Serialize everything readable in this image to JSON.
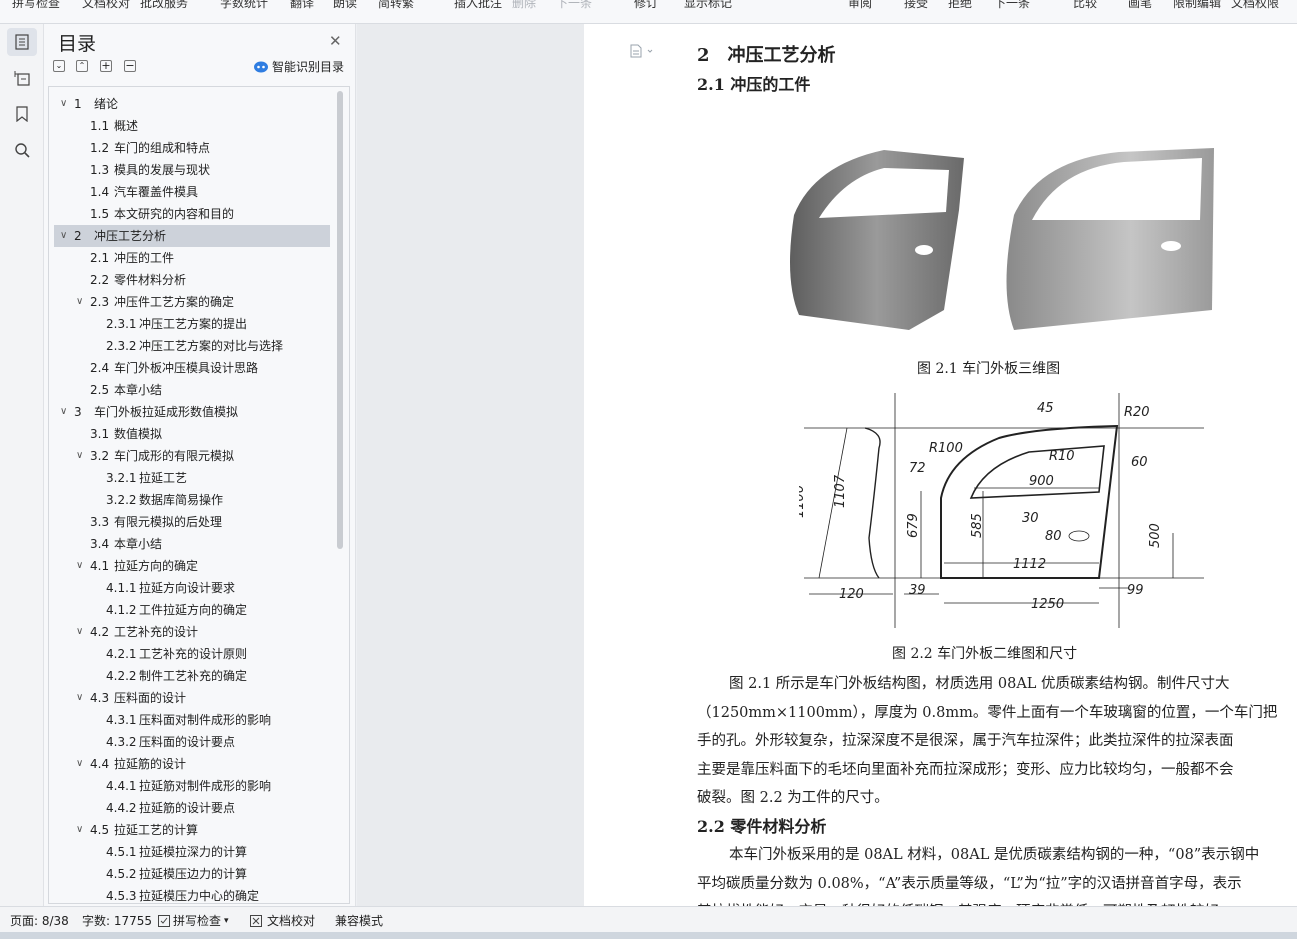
{
  "toolbar": {
    "items": [
      {
        "label": "拼写检查",
        "dim": false
      },
      {
        "label": "文档校对",
        "dim": false
      },
      {
        "label": "批改服务",
        "dim": false
      },
      {
        "label": "字数统计",
        "dim": false
      },
      {
        "label": "翻译",
        "dim": false
      },
      {
        "label": "朗读",
        "dim": false
      },
      {
        "label": "简转繁",
        "dim": false
      },
      {
        "label": "插入批注",
        "dim": false
      },
      {
        "label": "删除",
        "dim": true
      },
      {
        "label": "下一条",
        "dim": true
      },
      {
        "label": "修订",
        "dim": false
      },
      {
        "label": "显示标记",
        "dim": false
      },
      {
        "label": "审阅",
        "dim": false
      },
      {
        "label": "接受",
        "dim": false
      },
      {
        "label": "拒绝",
        "dim": false
      },
      {
        "label": "下一条",
        "dim": false
      },
      {
        "label": "比较",
        "dim": false
      },
      {
        "label": "画笔",
        "dim": false
      },
      {
        "label": "限制编辑",
        "dim": false
      },
      {
        "label": "文档权限",
        "dim": false
      }
    ]
  },
  "toc": {
    "title": "目录",
    "smart_label": "智能识别目录",
    "items": [
      {
        "num": "1",
        "label": "绪论",
        "level": 1,
        "expandable": true
      },
      {
        "num": "1.1",
        "label": "概述",
        "level": 2,
        "expandable": false
      },
      {
        "num": "1.2",
        "label": "车门的组成和特点",
        "level": 2,
        "expandable": false
      },
      {
        "num": "1.3",
        "label": "模具的发展与现状",
        "level": 2,
        "expandable": false
      },
      {
        "num": "1.4",
        "label": "汽车覆盖件模具",
        "level": 2,
        "expandable": false
      },
      {
        "num": "1.5",
        "label": "本文研究的内容和目的",
        "level": 2,
        "expandable": false
      },
      {
        "num": "2",
        "label": "冲压工艺分析",
        "level": 1,
        "expandable": true,
        "selected": true
      },
      {
        "num": "2.1",
        "label": "冲压的工件",
        "level": 2,
        "expandable": false
      },
      {
        "num": "2.2",
        "label": "零件材料分析",
        "level": 2,
        "expandable": false
      },
      {
        "num": "2.3",
        "label": "冲压件工艺方案的确定",
        "level": 2,
        "expandable": true
      },
      {
        "num": "2.3.1",
        "label": "冲压工艺方案的提出",
        "level": 3,
        "expandable": false
      },
      {
        "num": "2.3.2",
        "label": "冲压工艺方案的对比与选择",
        "level": 3,
        "expandable": false
      },
      {
        "num": "2.4",
        "label": "车门外板冲压模具设计思路",
        "level": 2,
        "expandable": false
      },
      {
        "num": "2.5",
        "label": "本章小结",
        "level": 2,
        "expandable": false
      },
      {
        "num": "3",
        "label": "车门外板拉延成形数值模拟",
        "level": 1,
        "expandable": true
      },
      {
        "num": "3.1",
        "label": "数值模拟",
        "level": 2,
        "expandable": false
      },
      {
        "num": "3.2",
        "label": "车门成形的有限元模拟",
        "level": 2,
        "expandable": true
      },
      {
        "num": "3.2.1",
        "label": "拉延工艺",
        "level": 3,
        "expandable": false
      },
      {
        "num": "3.2.2",
        "label": "数据库简易操作",
        "level": 3,
        "expandable": false
      },
      {
        "num": "3.3",
        "label": "有限元模拟的后处理",
        "level": 2,
        "expandable": false
      },
      {
        "num": "3.4",
        "label": "本章小结",
        "level": 2,
        "expandable": false
      },
      {
        "num": "4.1",
        "label": "拉延方向的确定",
        "level": 2,
        "expandable": true
      },
      {
        "num": "4.1.1",
        "label": "拉延方向设计要求",
        "level": 3,
        "expandable": false
      },
      {
        "num": "4.1.2",
        "label": "工件拉延方向的确定",
        "level": 3,
        "expandable": false
      },
      {
        "num": "4.2",
        "label": "工艺补充的设计",
        "level": 2,
        "expandable": true
      },
      {
        "num": "4.2.1",
        "label": "工艺补充的设计原则",
        "level": 3,
        "expandable": false
      },
      {
        "num": "4.2.2",
        "label": "制件工艺补充的确定",
        "level": 3,
        "expandable": false
      },
      {
        "num": "4.3",
        "label": "压料面的设计",
        "level": 2,
        "expandable": true
      },
      {
        "num": "4.3.1",
        "label": "压料面对制件成形的影响",
        "level": 3,
        "expandable": false
      },
      {
        "num": "4.3.2",
        "label": "压料面的设计要点",
        "level": 3,
        "expandable": false
      },
      {
        "num": "4.4",
        "label": "拉延筋的设计",
        "level": 2,
        "expandable": true
      },
      {
        "num": "4.4.1",
        "label": "拉延筋对制件成形的影响",
        "level": 3,
        "expandable": false
      },
      {
        "num": "4.4.2",
        "label": "拉延筋的设计要点",
        "level": 3,
        "expandable": false
      },
      {
        "num": "4.5",
        "label": "拉延工艺的计算",
        "level": 2,
        "expandable": true
      },
      {
        "num": "4.5.1",
        "label": "拉延模拉深力的计算",
        "level": 3,
        "expandable": false
      },
      {
        "num": "4.5.2",
        "label": "拉延模压边力的计算",
        "level": 3,
        "expandable": false
      },
      {
        "num": "4.5.3",
        "label": "拉延模压力中心的确定",
        "level": 3,
        "expandable": false
      }
    ]
  },
  "document": {
    "heading1": "2　冲压工艺分析",
    "heading2_1": "2.1  冲压的工件",
    "figure1_caption": "图 2.1  车门外板三维图",
    "figure2_caption": "图 2.2  车门外板二维图和尺寸",
    "drawing_dims": [
      "45",
      "R20",
      "R100",
      "R10",
      "60",
      "72",
      "900",
      "1100",
      "1107",
      "679",
      "585",
      "30",
      "80",
      "500",
      "1112",
      "39",
      "1250",
      "120",
      "99"
    ],
    "paragraph1": [
      "图 2.1 所示是车门外板结构图，材质选用 08AL 优质碳素结构钢。制件尺寸大",
      "（1250mm×1100mm），厚度为 0.8mm。零件上面有一个车玻璃窗的位置，一个车门把",
      "手的孔。外形较复杂，拉深深度不是很深，属于汽车拉深件；此类拉深件的拉深表面",
      "主要是靠压料面下的毛坯向里面补充而拉深成形；变形、应力比较均匀，一般都不会",
      "破裂。图 2.2 为工件的尺寸。"
    ],
    "heading2_2": "2.2  零件材料分析",
    "paragraph2": [
      "本车门外板采用的是 08AL 材料，08AL 是优质碳素结构钢的一种，“08”表示钢中",
      "平均碳质量分数为 0.08%，“A”表示质量等级，“L”为“拉”字的汉语拼音首字母，表示",
      "其拉拔性能好。它是一种很好的低碳钢，其强度、硬度非常低，可塑性及韧性较好。"
    ]
  },
  "status": {
    "page": "页面: 8/38",
    "words": "字数: 17755",
    "spell": "拼写检查",
    "proof": "文档校对",
    "compat": "兼容模式"
  }
}
